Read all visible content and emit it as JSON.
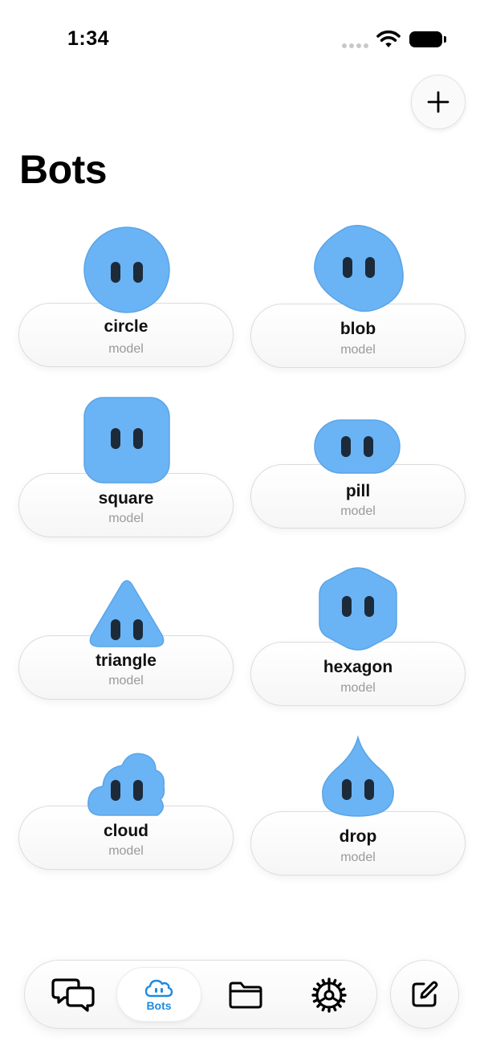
{
  "status_bar": {
    "time": "1:34"
  },
  "header": {
    "title": "Bots",
    "add_icon": "plus-icon"
  },
  "bots": [
    {
      "name": "circle",
      "model": "model",
      "shape": "circle"
    },
    {
      "name": "blob",
      "model": "model",
      "shape": "blob"
    },
    {
      "name": "square",
      "model": "model",
      "shape": "square"
    },
    {
      "name": "pill",
      "model": "model",
      "shape": "pill"
    },
    {
      "name": "triangle",
      "model": "model",
      "shape": "triangle"
    },
    {
      "name": "hexagon",
      "model": "model",
      "shape": "hexagon"
    },
    {
      "name": "cloud",
      "model": "model",
      "shape": "cloud"
    },
    {
      "name": "drop",
      "model": "model",
      "shape": "drop"
    }
  ],
  "tab_bar": {
    "tabs": [
      {
        "icon": "chat-bubbles-icon",
        "label": ""
      },
      {
        "icon": "bot-cloud-icon",
        "label": "Bots",
        "active": true
      },
      {
        "icon": "folder-icon",
        "label": ""
      },
      {
        "icon": "gear-icon",
        "label": ""
      }
    ],
    "compose_icon": "compose-icon"
  },
  "colors": {
    "bot_blue": "#6ab4f5",
    "accent": "#1f8ae0",
    "eye": "#1c2a3a"
  }
}
